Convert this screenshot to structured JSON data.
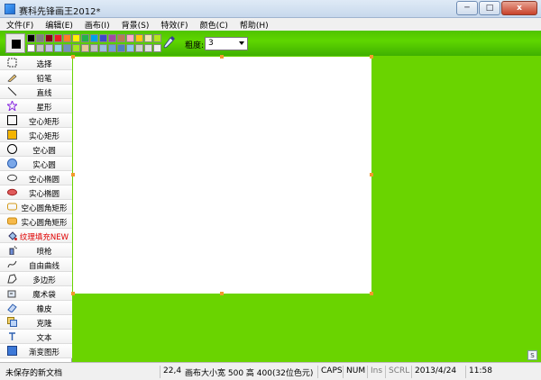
{
  "window": {
    "title": "赛科先锋画王2012*",
    "min_glyph": "─",
    "max_glyph": "□",
    "close_glyph": "x"
  },
  "menu": [
    "文件(F)",
    "编辑(E)",
    "画布(I)",
    "背景(S)",
    "特效(F)",
    "颜色(C)",
    "帮助(H)"
  ],
  "toolbar": {
    "current_color": "#000000",
    "palette_row1": [
      "#000000",
      "#7f7f7f",
      "#880015",
      "#ed1c24",
      "#ff7f27",
      "#fff200",
      "#22b14c",
      "#00a2e8",
      "#3f48cc",
      "#a349a4",
      "#b97a57",
      "#ffaec9",
      "#ffc90e",
      "#efe4b0",
      "#b5e61d"
    ],
    "palette_row2": [
      "#ffffff",
      "#c3c3c3",
      "#c8bfe7",
      "#99d9ea",
      "#7092be",
      "#a8e61d",
      "#e6c896",
      "#c0c0c0",
      "#9bbfe0",
      "#6f9fd8",
      "#4f7fc0",
      "#8cc8f0",
      "#d0d0d0",
      "#e0e0e0",
      "#f0f0f0"
    ],
    "width_label": "粗度:",
    "width_value": "3"
  },
  "tools": [
    {
      "id": "select",
      "label": "选择",
      "icon": "select-icon"
    },
    {
      "id": "pencil",
      "label": "铅笔",
      "icon": "pencil-icon"
    },
    {
      "id": "line",
      "label": "直线",
      "icon": "line-icon"
    },
    {
      "id": "star",
      "label": "星形",
      "icon": "star-icon"
    },
    {
      "id": "hollow-rect",
      "label": "空心矩形",
      "icon": "hollow-rect-icon"
    },
    {
      "id": "solid-rect",
      "label": "实心矩形",
      "icon": "solid-rect-icon"
    },
    {
      "id": "hollow-circle",
      "label": "空心圆",
      "icon": "hollow-circle-icon"
    },
    {
      "id": "solid-circle",
      "label": "实心圆",
      "icon": "solid-circle-icon"
    },
    {
      "id": "hollow-ellipse",
      "label": "空心椭圆",
      "icon": "hollow-ellipse-icon"
    },
    {
      "id": "solid-ellipse",
      "label": "实心椭圆",
      "icon": "solid-ellipse-icon"
    },
    {
      "id": "hollow-round-rect",
      "label": "空心圆角矩形",
      "icon": "hollow-round-rect-icon"
    },
    {
      "id": "solid-round-rect",
      "label": "实心圆角矩形",
      "icon": "solid-round-rect-icon"
    },
    {
      "id": "texture-fill",
      "label": "纹理填充NEW",
      "icon": "texture-fill-icon"
    },
    {
      "id": "spray",
      "label": "喷枪",
      "icon": "spray-icon"
    },
    {
      "id": "freeform",
      "label": "自由曲线",
      "icon": "freeform-icon"
    },
    {
      "id": "polygon",
      "label": "多边形",
      "icon": "polygon-icon"
    },
    {
      "id": "magic-wand",
      "label": "魔术袋",
      "icon": "magic-wand-icon"
    },
    {
      "id": "eraser",
      "label": "橡皮",
      "icon": "eraser-icon"
    },
    {
      "id": "clone",
      "label": "克隆",
      "icon": "clone-icon"
    },
    {
      "id": "text",
      "label": "文本",
      "icon": "text-icon"
    },
    {
      "id": "gradient",
      "label": "渐变图形",
      "icon": "gradient-icon"
    }
  ],
  "canvas": {
    "corner_button_label": "S"
  },
  "status": {
    "document": "未保存的新文档",
    "coords": "22,4",
    "canvas_size": "画布大小宽 500 高 400(32位色元)",
    "caps": "CAPS",
    "num": "NUM",
    "ins": "Ins",
    "scrl": "SCRL",
    "date": "2013/4/24",
    "time": "11:58"
  },
  "colors": {
    "accent_green": "#6ad400",
    "handle_orange": "#f29a2e"
  }
}
